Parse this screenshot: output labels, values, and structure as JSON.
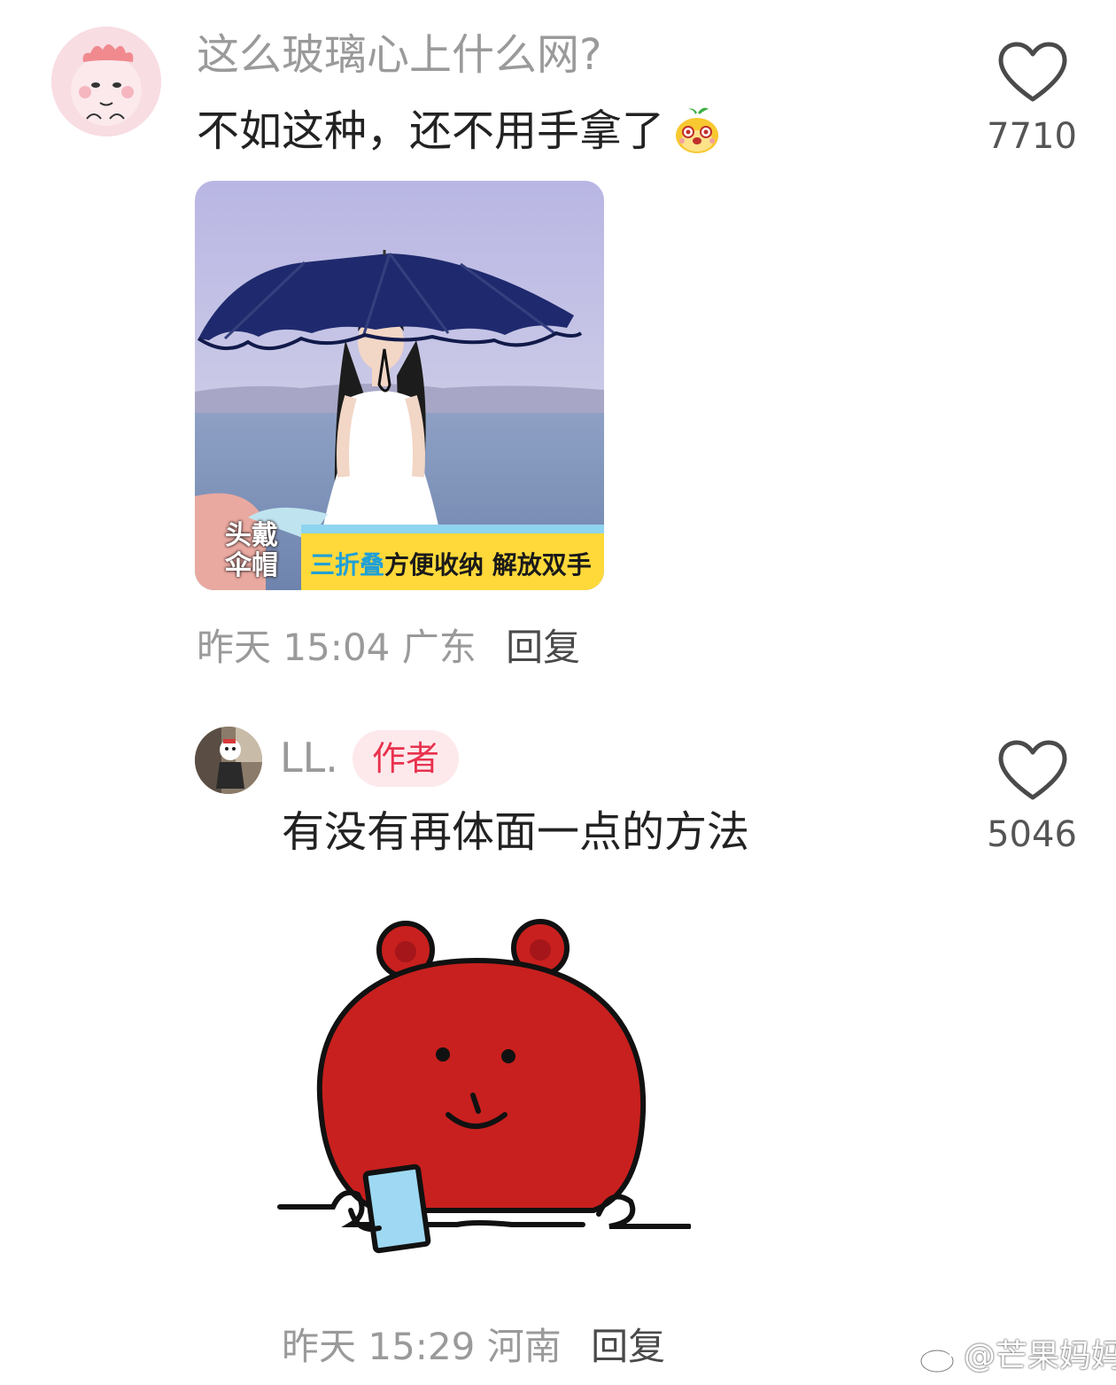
{
  "comments": [
    {
      "avatar": "pink-cartoon-avatar",
      "question": "这么玻璃心上什么网?",
      "body": "不如这种，还不用手拿了",
      "emoji": "cute-mango-face-emoji",
      "like_icon": "heart-outline-icon",
      "like_count": "7710",
      "image": {
        "tag": [
          "头戴",
          "伞帽"
        ],
        "banner_highlight": "三折叠",
        "banner_text": "方便收纳 解放双手"
      },
      "time": "昨天 15:04",
      "location": "广东",
      "reply_label": "回复"
    },
    {
      "avatar": "photo-avatar",
      "username": "LL.",
      "badge": "作者",
      "body": "有没有再体面一点的方法",
      "sticker": "red-bear-sticker",
      "like_icon": "heart-outline-icon",
      "like_count": "5046",
      "time": "昨天 15:29",
      "location": "河南",
      "reply_label": "回复"
    }
  ],
  "watermark": "@芒果妈妈",
  "colors": {
    "secondary_text": "#9a9a9a",
    "primary_text": "#222222",
    "author_badge_text": "#e8324e",
    "author_badge_bg": "#fde9ec",
    "bear_red": "#c8201e"
  }
}
